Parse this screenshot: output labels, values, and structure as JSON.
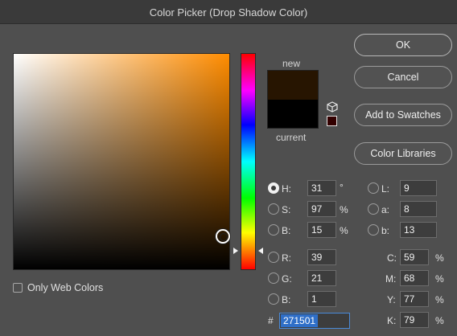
{
  "window": {
    "title": "Color Picker (Drop Shadow Color)"
  },
  "preview": {
    "new_label": "new",
    "current_label": "current",
    "new_color": "#271501",
    "current_color": "#000000",
    "websafe_color": "#330000",
    "cube_icon": "cube-icon"
  },
  "buttons": {
    "ok": "OK",
    "cancel": "Cancel",
    "add_to_swatches": "Add to Swatches",
    "color_libraries": "Color Libraries"
  },
  "hsb": {
    "h_label": "H:",
    "h_value": "31",
    "h_unit": "°",
    "s_label": "S:",
    "s_value": "97",
    "s_unit": "%",
    "b_label": "B:",
    "b_value": "15",
    "b_unit": "%",
    "selected": "H"
  },
  "rgb": {
    "r_label": "R:",
    "r_value": "39",
    "g_label": "G:",
    "g_value": "21",
    "b_label": "B:",
    "b_value": "1"
  },
  "lab": {
    "l_label": "L:",
    "l_value": "9",
    "a_label": "a:",
    "a_value": "8",
    "b_label": "b:",
    "b_value": "13"
  },
  "cmyk": {
    "c_label": "C:",
    "c_value": "59",
    "c_unit": "%",
    "m_label": "M:",
    "m_value": "68",
    "m_unit": "%",
    "y_label": "Y:",
    "y_value": "77",
    "y_unit": "%",
    "k_label": "K:",
    "k_value": "79",
    "k_unit": "%"
  },
  "hex": {
    "label": "#",
    "value": "271501"
  },
  "web_colors": {
    "label": "Only Web Colors",
    "checked": false
  }
}
